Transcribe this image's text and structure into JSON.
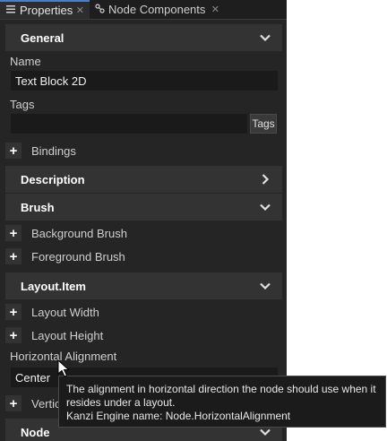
{
  "tabs": [
    {
      "label": "Properties",
      "icon": "properties-icon",
      "active": true
    },
    {
      "label": "Node Components",
      "icon": "node-components-icon",
      "active": false
    }
  ],
  "sections": {
    "general": "General",
    "description": "Description",
    "brush": "Brush",
    "layout_item": "Layout.Item",
    "node": "Node"
  },
  "general": {
    "name_label": "Name",
    "name_value": "Text Block 2D",
    "tags_label": "Tags",
    "tags_value": "",
    "tags_button": "Tags",
    "bindings": "Bindings"
  },
  "brush": {
    "background": "Background Brush",
    "foreground": "Foreground Brush"
  },
  "layout_item": {
    "width": "Layout Width",
    "height": "Layout Height",
    "halign_label": "Horizontal Alignment",
    "halign_value": "Center",
    "valign_partial": "Vertic"
  },
  "tooltip": {
    "line1": "The alignment in horizontal direction the node should use when it",
    "line2": "resides under a layout.",
    "line3": "Kanzi Engine name: Node.HorizontalAlignment"
  },
  "colors": {
    "panel_bg": "#252525",
    "section_bg": "#333333",
    "field_bg": "#1a1a1a",
    "accent": "#4c7fc2"
  }
}
